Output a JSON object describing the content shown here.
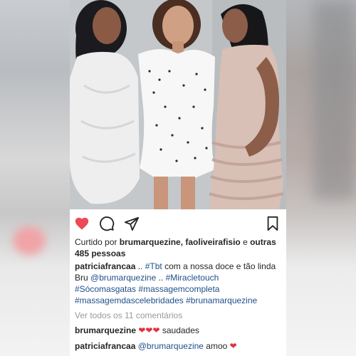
{
  "actions": {
    "like_color": "#ed4956",
    "icons": [
      "heart-icon",
      "comment-icon",
      "share-icon",
      "bookmark-icon"
    ]
  },
  "likes": {
    "prefix": "Curtido por ",
    "users": "brumarquezine, faoliveirafisio",
    "connector": " e ",
    "others": "outras 485 pessoas"
  },
  "caption": {
    "user": "patriciafrancaa",
    "text_1": " .. ",
    "tag_1": "#Tbt",
    "text_2": " com a nossa doce e tão linda Bru ",
    "mention_1": "@brumarquezine",
    "text_3": " .. ",
    "tag_2": "#Miracletouch",
    "tag_3": "#Sócomasgatas",
    "tag_4": "#massagemcompleta",
    "tag_5": "#massagemdascelebridades",
    "tag_6": "#brunamarquezine"
  },
  "view_all": "Ver todos os 11 comentários",
  "comments": [
    {
      "user": "brumarquezine",
      "hearts": "❤❤❤",
      "text": " saudades"
    },
    {
      "user": "patriciafrancaa",
      "mention": "@brumarquezine",
      "text": " amoo ",
      "heart": "❤"
    }
  ]
}
